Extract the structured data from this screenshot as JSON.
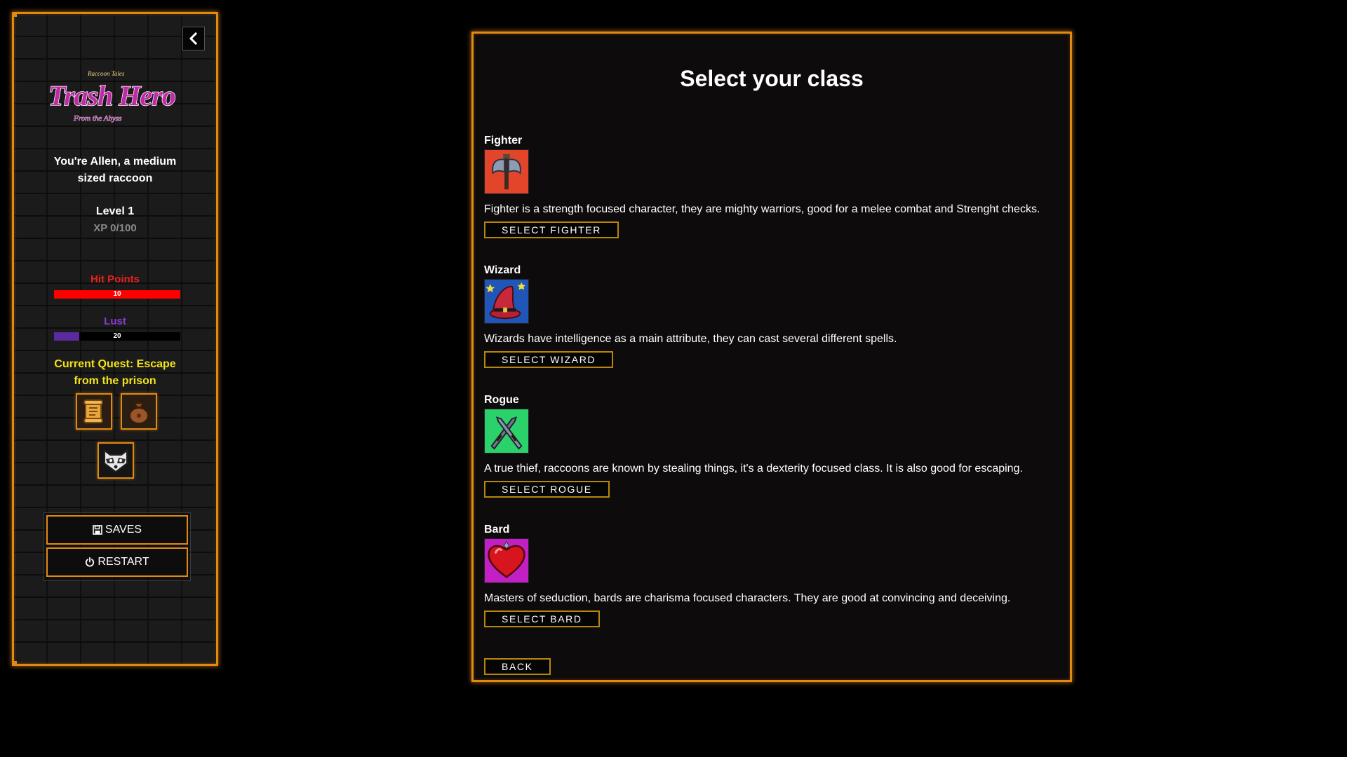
{
  "sidebar": {
    "collapse_icon": "chevron-left-icon",
    "logo": {
      "small_top": "Raccoon Tales",
      "main": "Trash Hero",
      "sub": "From the Abyss"
    },
    "intro": "You're Allen, a medium sized raccoon",
    "level": "Level 1",
    "xp": "XP 0/100",
    "hit_points": {
      "label": "Hit Points",
      "value": "10",
      "fraction": 1.0,
      "color": "#ff0000"
    },
    "lust": {
      "label": "Lust",
      "value": "20",
      "fraction": 0.2,
      "color": "#5b2a9e"
    },
    "quest": "Current Quest: Escape from the prison",
    "inventory_icons": [
      "scroll-icon",
      "bag-icon",
      "raccoon-icon"
    ],
    "saves_label": "SAVES",
    "restart_label": "RESTART"
  },
  "main": {
    "title": "Select your class",
    "classes": [
      {
        "name": "Fighter",
        "icon": "axe-icon",
        "description": "Fighter is a strength focused character, they are mighty warriors, good for a melee combat and Strenght checks.",
        "button": "SELECT FIGHTER"
      },
      {
        "name": "Wizard",
        "icon": "wizard-hat-icon",
        "description": "Wizards have intelligence as a main attribute, they can cast several different spells.",
        "button": "SELECT WIZARD"
      },
      {
        "name": "Rogue",
        "icon": "daggers-icon",
        "description": "A true thief, raccoons are known by stealing things, it's a dexterity focused class. It is also good for escaping.",
        "button": "SELECT ROGUE"
      },
      {
        "name": "Bard",
        "icon": "heart-icon",
        "description": "Masters of seduction, bards are charisma focused characters. They are good at convincing and deceiving.",
        "button": "SELECT BARD"
      }
    ],
    "back_label": "BACK"
  },
  "colors": {
    "accent": "#e08a12",
    "quest": "#f2e21a",
    "hp": "#e8211c",
    "lust": "#8b3bd6"
  }
}
